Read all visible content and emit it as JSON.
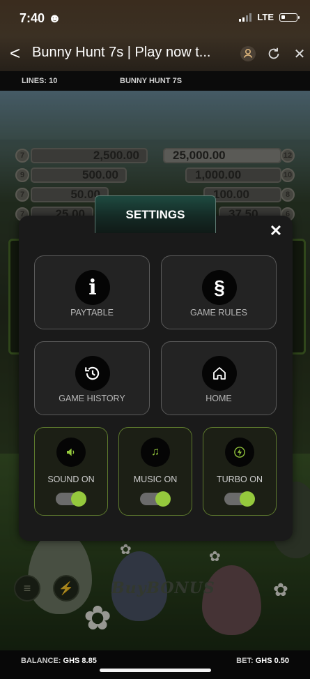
{
  "status_bar": {
    "time": "7:40",
    "network": "LTE"
  },
  "browser": {
    "title": "Bunny Hunt 7s | Play now t...",
    "back_glyph": "<",
    "close_glyph": "✕"
  },
  "game_header": {
    "lines": "LINES: 10",
    "game_name": "BUNNY HUNT 7S"
  },
  "paytable_bg": {
    "left": [
      {
        "badge": "7",
        "value": "2,500.00"
      },
      {
        "badge": "9",
        "value": "500.00"
      },
      {
        "badge": "7",
        "value": "50.00"
      },
      {
        "badge": "7",
        "value": "25.00"
      }
    ],
    "right": [
      {
        "badge": "12",
        "value": "25,000.00"
      },
      {
        "badge": "10",
        "value": "1,000.00"
      },
      {
        "badge": "8",
        "value": "100.00"
      },
      {
        "badge": "6",
        "value": "37.50"
      }
    ]
  },
  "background": {
    "buy_bonus": "BuyBONUS"
  },
  "settings": {
    "title": "SETTINGS",
    "close": "✕",
    "tiles": {
      "paytable": {
        "label": "PAYTABLE",
        "glyph": "i"
      },
      "game_rules": {
        "label": "GAME RULES",
        "glyph": "§"
      },
      "game_history": {
        "label": "GAME HISTORY"
      },
      "home": {
        "label": "HOME"
      }
    },
    "toggles": {
      "sound": {
        "label": "SOUND ON",
        "on": true
      },
      "music": {
        "label": "MUSIC ON",
        "on": true
      },
      "turbo": {
        "label": "TURBO ON",
        "on": true
      }
    },
    "accent_color": "#95c93d"
  },
  "footer": {
    "balance_label": "BALANCE:",
    "balance_value": "GHS 8.85",
    "bet_label": "BET:",
    "bet_value": "GHS 0.50"
  }
}
